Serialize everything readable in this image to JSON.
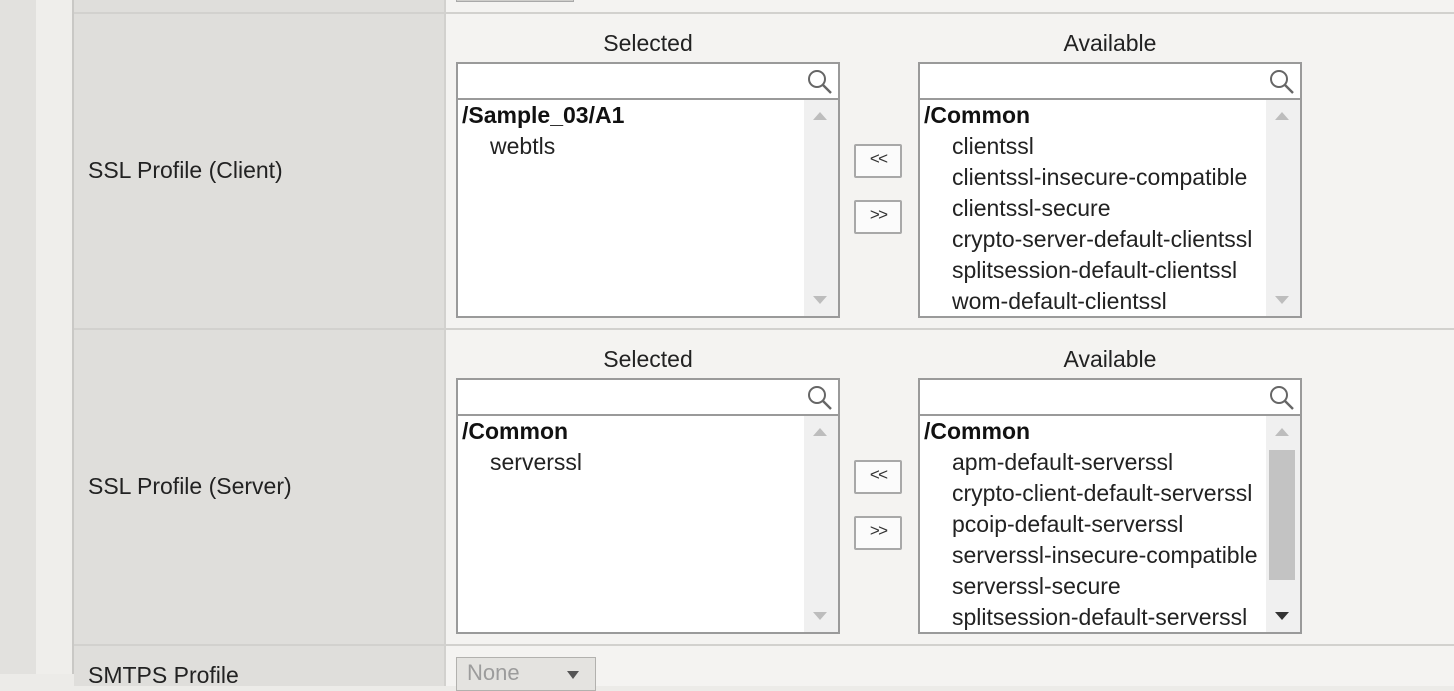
{
  "ssl_client": {
    "label": "SSL Profile (Client)",
    "selected_title": "Selected",
    "available_title": "Available",
    "selected_search": "",
    "available_search": "",
    "selected_group": "/Sample_03/A1",
    "selected_items": [
      "webtls"
    ],
    "available_group": "/Common",
    "available_items": [
      "clientssl",
      "clientssl-insecure-compatible",
      "clientssl-secure",
      "crypto-server-default-clientssl",
      "splitsession-default-clientssl",
      "wom-default-clientssl"
    ],
    "move_left_label": "<<",
    "move_right_label": ">>"
  },
  "ssl_server": {
    "label": "SSL Profile (Server)",
    "selected_title": "Selected",
    "available_title": "Available",
    "selected_search": "",
    "available_search": "",
    "selected_group": "/Common",
    "selected_items": [
      "serverssl"
    ],
    "available_group": "/Common",
    "available_items": [
      "apm-default-serverssl",
      "crypto-client-default-serverssl",
      "pcoip-default-serverssl",
      "serverssl-insecure-compatible",
      "serverssl-secure",
      "splitsession-default-serverssl"
    ],
    "move_left_label": "<<",
    "move_right_label": ">>"
  },
  "smtps": {
    "label": "SMTPS Profile",
    "value": "None"
  },
  "icons": {
    "search": "search-icon",
    "scroll_up": "scroll-up-arrow-icon",
    "scroll_down": "scroll-down-arrow-icon",
    "dropdown": "chevron-down-icon"
  }
}
